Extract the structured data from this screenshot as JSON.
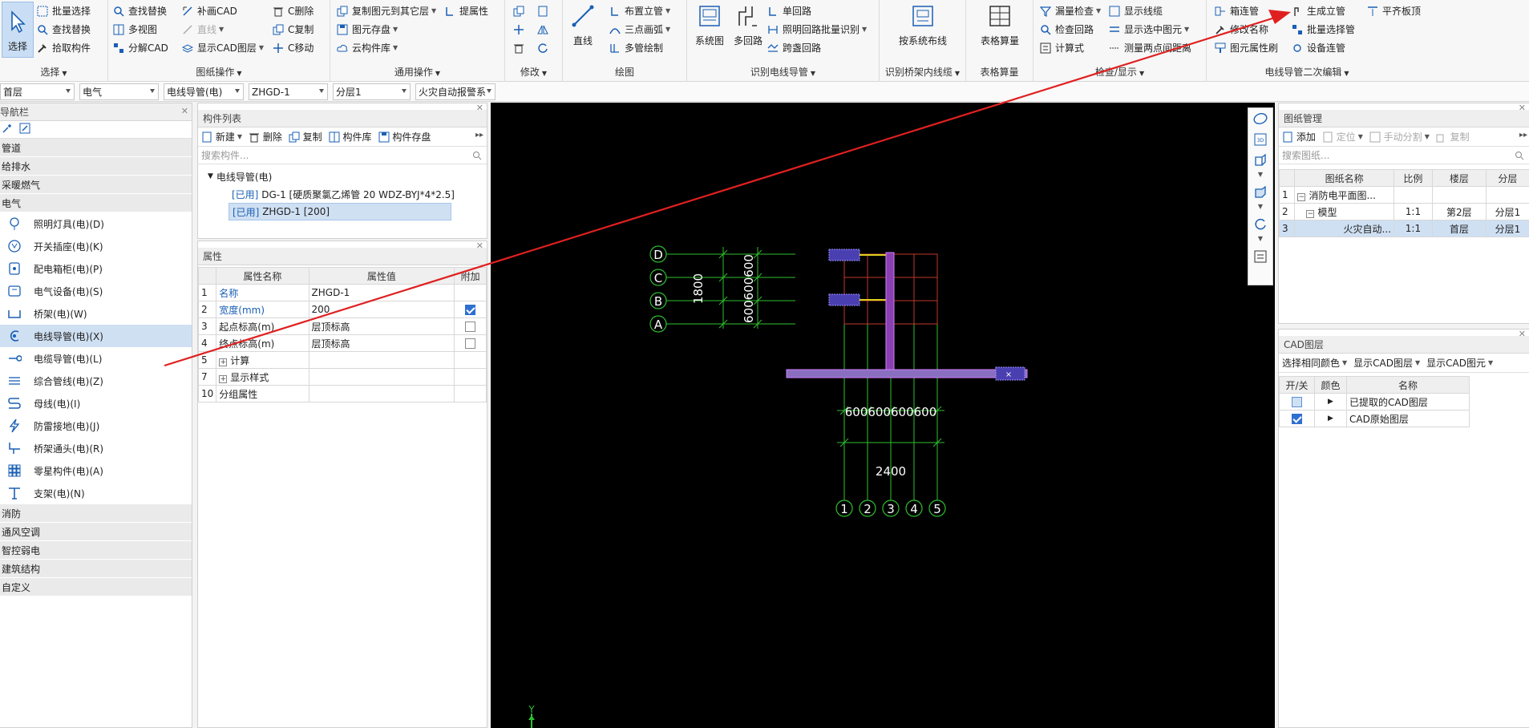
{
  "ribbon": {
    "groups": [
      {
        "label": "选择"
      },
      {
        "label": "图纸操作"
      },
      {
        "label": "通用操作"
      },
      {
        "label": "修改"
      },
      {
        "label": "绘图"
      },
      {
        "label": "识别电线导管"
      },
      {
        "label": "识别桥架内线缆"
      },
      {
        "label": "表格算量"
      },
      {
        "label": "检查/显示"
      },
      {
        "label": "电线导管二次编辑"
      }
    ],
    "select_big": "选择",
    "select": [
      "批量选择",
      "查找替换",
      "拾取构件"
    ],
    "drawing": [
      "查找替换",
      "多视图",
      "分解CAD",
      "补画CAD",
      "直线",
      "显示CAD图层",
      "C删除",
      "C复制",
      "C移动"
    ],
    "general": [
      "复制图元到其它层",
      "提属性",
      "图元存盘",
      "云构件库"
    ],
    "draw_line": "直线",
    "draw": [
      "布置立管",
      "三点画弧",
      "多管绘制"
    ],
    "recog_big": [
      "系统图",
      "多回路"
    ],
    "recog": [
      "单回路",
      "照明回路批量识别",
      "跨盏回路"
    ],
    "tray_big": "按系统布线",
    "table_big": "表格算量",
    "check": [
      "漏量检查",
      "检查回路",
      "计算式",
      "显示线缆",
      "显示选中图元",
      "测量两点间距离"
    ],
    "edit2": [
      "箱连管",
      "修改名称",
      "图元属性刷",
      "生成立管",
      "批量选择管",
      "设备连管",
      "平齐板顶"
    ]
  },
  "toolbar2": {
    "floor": "首层",
    "major": "电气",
    "type": "电线导管(电)",
    "component": "ZHGD-1",
    "layer": "分层1",
    "drawing": "火灾自动报警系"
  },
  "nav": {
    "title": "导航栏",
    "cats_top": [
      "管道",
      "给排水",
      "采暖燃气",
      "电气"
    ],
    "items": [
      {
        "label": "照明灯具(电)(D)",
        "icon": "lamp-icon"
      },
      {
        "label": "开关插座(电)(K)",
        "icon": "switch-icon"
      },
      {
        "label": "配电箱柜(电)(P)",
        "icon": "cabinet-icon"
      },
      {
        "label": "电气设备(电)(S)",
        "icon": "device-icon"
      },
      {
        "label": "桥架(电)(W)",
        "icon": "tray-icon"
      },
      {
        "label": "电线导管(电)(X)",
        "icon": "conduit-icon"
      },
      {
        "label": "电缆导管(电)(L)",
        "icon": "cable-icon"
      },
      {
        "label": "综合管线(电)(Z)",
        "icon": "pipeline-icon"
      },
      {
        "label": "母线(电)(I)",
        "icon": "busbar-icon"
      },
      {
        "label": "防雷接地(电)(J)",
        "icon": "lightning-icon"
      },
      {
        "label": "桥架通头(电)(R)",
        "icon": "tee-icon"
      },
      {
        "label": "零星构件(电)(A)",
        "icon": "parts-icon"
      },
      {
        "label": "支架(电)(N)",
        "icon": "bracket-icon"
      }
    ],
    "cats_bottom": [
      "消防",
      "通风空调",
      "智控弱电",
      "建筑结构",
      "自定义"
    ]
  },
  "complist": {
    "title": "构件列表",
    "tools": [
      "新建",
      "删除",
      "复制",
      "构件库",
      "构件存盘"
    ],
    "search_placeholder": "搜索构件...",
    "group": "电线导管(电)",
    "items": [
      {
        "tag": "[已用]",
        "text": "DG-1 [硬质聚氯乙烯管 20 WDZ-BYJ*4*2.5]"
      },
      {
        "tag": "[已用]",
        "text": "ZHGD-1 [200]"
      }
    ]
  },
  "props": {
    "title": "属性",
    "headers": [
      "属性名称",
      "属性值",
      "附加"
    ],
    "rows": [
      {
        "no": "1",
        "name": "名称",
        "value": "ZHGD-1"
      },
      {
        "no": "2",
        "name": "宽度(mm)",
        "value": "200"
      },
      {
        "no": "3",
        "name": "起点标高(m)",
        "value": "层顶标高"
      },
      {
        "no": "4",
        "name": "终点标高(m)",
        "value": "层顶标高"
      },
      {
        "no": "5",
        "name": "计算",
        "value": ""
      },
      {
        "no": "7",
        "name": "显示样式",
        "value": ""
      },
      {
        "no": "10",
        "name": "分组属性",
        "value": ""
      }
    ]
  },
  "cad": {
    "row_labels": [
      "D",
      "C",
      "B",
      "A"
    ],
    "col_labels": [
      "1",
      "2",
      "3",
      "4",
      "5"
    ],
    "dim_1800": "1800",
    "dim_vert": "600600600",
    "dim_horiz": "600600600600",
    "dim_2400": "2400",
    "axis_y": "Y"
  },
  "drawings": {
    "title": "图纸管理",
    "tools": [
      "添加",
      "定位",
      "手动分割",
      "复制"
    ],
    "search_placeholder": "搜索图纸...",
    "headers": [
      "图纸名称",
      "比例",
      "楼层",
      "分层"
    ],
    "rows": [
      {
        "no": "1",
        "name": "消防电平面图...",
        "scale": "",
        "floor": "",
        "layer": ""
      },
      {
        "no": "2",
        "name": "模型",
        "scale": "1:1",
        "floor": "第2层",
        "layer": "分层1"
      },
      {
        "no": "3",
        "name": "火灾自动...",
        "scale": "1:1",
        "floor": "首层",
        "layer": "分层1"
      }
    ]
  },
  "cadlayers": {
    "title": "CAD图层",
    "tools": [
      "选择相同颜色",
      "显示CAD图层",
      "显示CAD图元"
    ],
    "headers": [
      "开/关",
      "颜色",
      "名称"
    ],
    "rows": [
      "已提取的CAD图层",
      "CAD原始图层"
    ]
  },
  "colors": {
    "accent": "#1a5fb4",
    "annotation_arrow": "#e02020",
    "canvas": "#000000",
    "cad_grid_green": "#2fbf2f",
    "cad_red": "#c0392b",
    "pipe_magenta": "#b040c0"
  }
}
